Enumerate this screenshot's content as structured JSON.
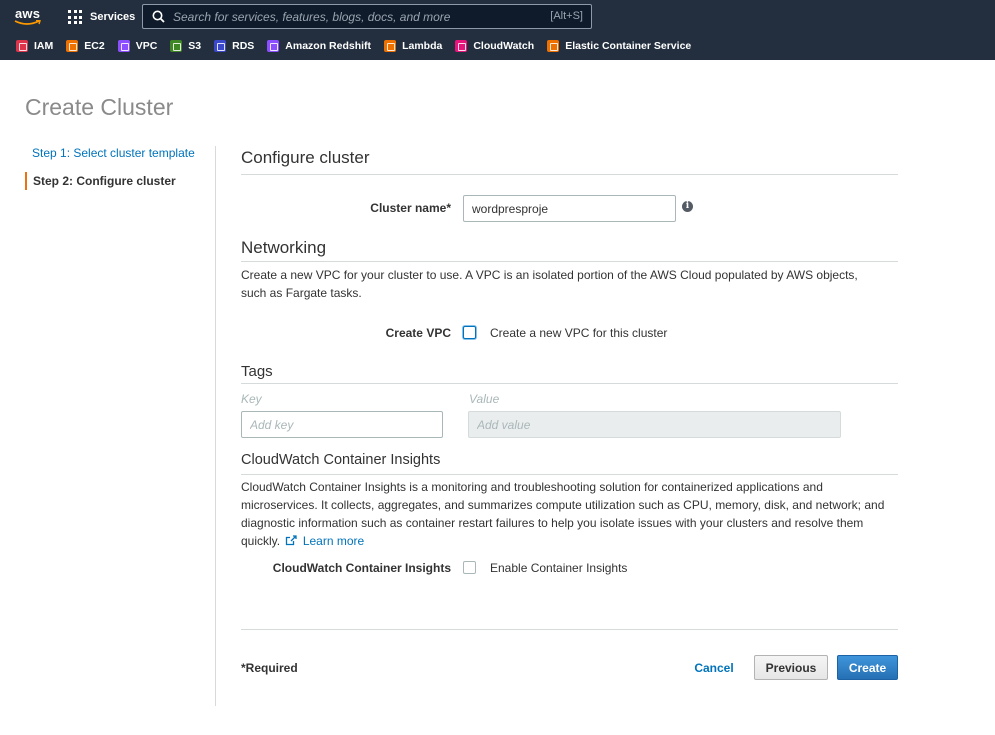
{
  "nav": {
    "logo": "aws",
    "services_label": "Services",
    "search_placeholder": "Search for services, features, blogs, docs, and more",
    "search_shortcut": "[Alt+S]",
    "favorites": [
      {
        "label": "IAM",
        "color": "#dd344c"
      },
      {
        "label": "EC2",
        "color": "#ed7100"
      },
      {
        "label": "VPC",
        "color": "#8c4fff"
      },
      {
        "label": "S3",
        "color": "#3f8624"
      },
      {
        "label": "RDS",
        "color": "#3b48cc"
      },
      {
        "label": "Amazon Redshift",
        "color": "#8c4fff"
      },
      {
        "label": "Lambda",
        "color": "#ed7100"
      },
      {
        "label": "CloudWatch",
        "color": "#e7157b"
      },
      {
        "label": "Elastic Container Service",
        "color": "#ed7100"
      }
    ]
  },
  "page": {
    "title": "Create Cluster"
  },
  "steps": {
    "step1": "Step 1: Select cluster template",
    "step2": "Step 2: Configure cluster"
  },
  "configure": {
    "heading": "Configure cluster",
    "cluster_name_label": "Cluster name*",
    "cluster_name_value": "wordpresproje",
    "info_icon": "i"
  },
  "networking": {
    "heading": "Networking",
    "description": "Create a new VPC for your cluster to use. A VPC is an isolated portion of the AWS Cloud populated by AWS objects, such as Fargate tasks.",
    "create_vpc_label": "Create VPC",
    "create_vpc_checkbox_label": "Create a new VPC for this cluster",
    "create_vpc_checked": false
  },
  "tags": {
    "heading": "Tags",
    "key_label": "Key",
    "value_label": "Value",
    "key_placeholder": "Add key",
    "value_placeholder": "Add value"
  },
  "cloudwatch": {
    "heading": "CloudWatch Container Insights",
    "description": "CloudWatch Container Insights is a monitoring and troubleshooting solution for containerized applications and microservices. It collects, aggregates, and summarizes compute utilization such as CPU, memory, disk, and network; and diagnostic information such as container restart failures to help you isolate issues with your clusters and resolve them quickly.",
    "learn_more": "Learn more",
    "field_label": "CloudWatch Container Insights",
    "checkbox_label": "Enable Container Insights",
    "checked": false
  },
  "footer": {
    "required_note": "*Required",
    "cancel": "Cancel",
    "previous": "Previous",
    "create": "Create"
  }
}
